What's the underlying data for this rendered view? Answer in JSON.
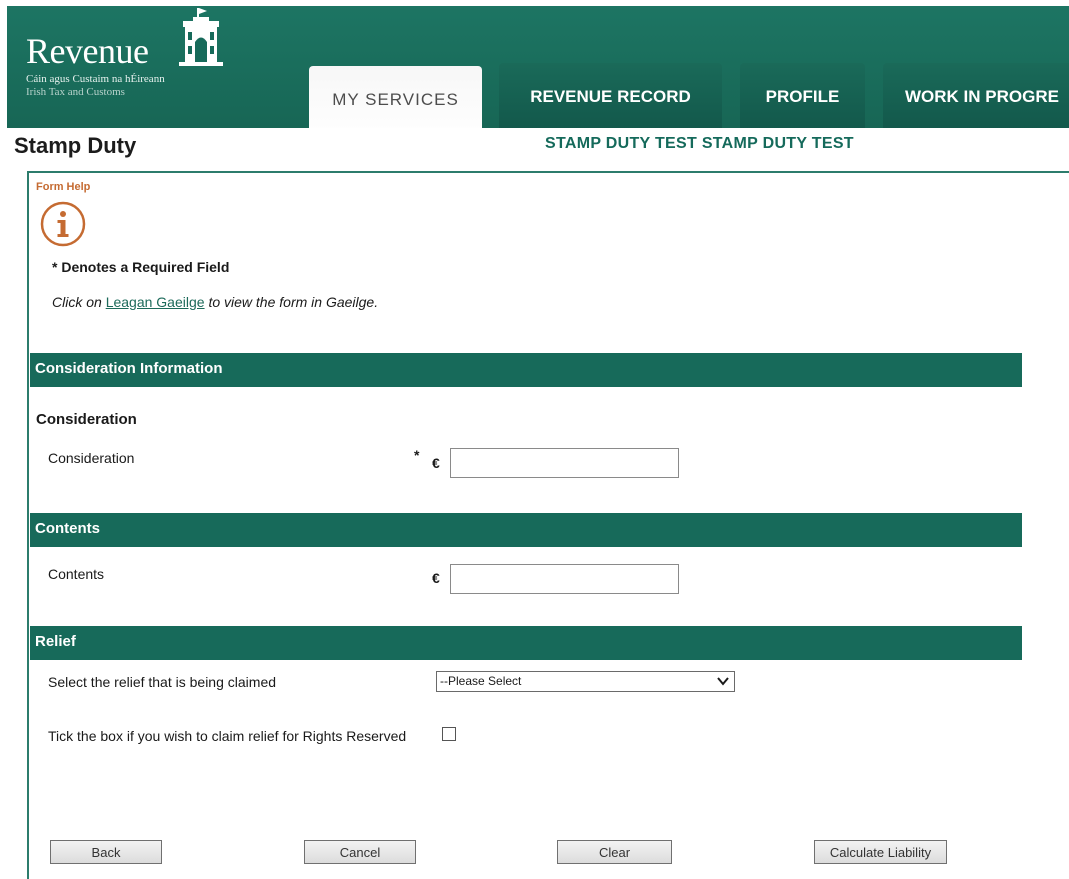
{
  "header": {
    "logo_word": "Revenue",
    "logo_sub_irish": "Cáin agus Custaim na hÉireann",
    "logo_sub_english": "Irish Tax and Customs",
    "tabs": [
      {
        "label": "MY SERVICES",
        "active": true
      },
      {
        "label": "REVENUE RECORD",
        "active": false
      },
      {
        "label": "PROFILE",
        "active": false
      },
      {
        "label": "WORK IN PROGRE",
        "active": false
      }
    ]
  },
  "page": {
    "title": "Stamp Duty",
    "user_name": "STAMP DUTY TEST STAMP DUTY TEST"
  },
  "form": {
    "help_label": "Form Help",
    "required_note": "* Denotes a Required Field",
    "lang_prefix": "Click on ",
    "lang_link": "Leagan Gaeilge",
    "lang_suffix": " to view the form in Gaeilge.",
    "sections": {
      "consideration_info": "Consideration Information",
      "contents": "Contents",
      "relief": "Relief"
    },
    "consideration": {
      "subheading": "Consideration",
      "label": "Consideration",
      "required_mark": "*",
      "currency": "€",
      "value": ""
    },
    "contents": {
      "label": "Contents",
      "currency": "€",
      "value": ""
    },
    "relief": {
      "select_label": "Select the relief that is being claimed",
      "selected_option": "--Please Select",
      "rights_label": "Tick the box if you wish to claim relief for Rights Reserved",
      "rights_checked": false
    }
  },
  "buttons": {
    "back": "Back",
    "cancel": "Cancel",
    "clear": "Clear",
    "calculate": "Calculate Liability"
  },
  "colors": {
    "brand_green": "#176a5a",
    "help_orange": "#c56b32"
  },
  "icons": {
    "help": "info-icon",
    "select": "chevron-down-icon",
    "logo": "building-icon"
  }
}
